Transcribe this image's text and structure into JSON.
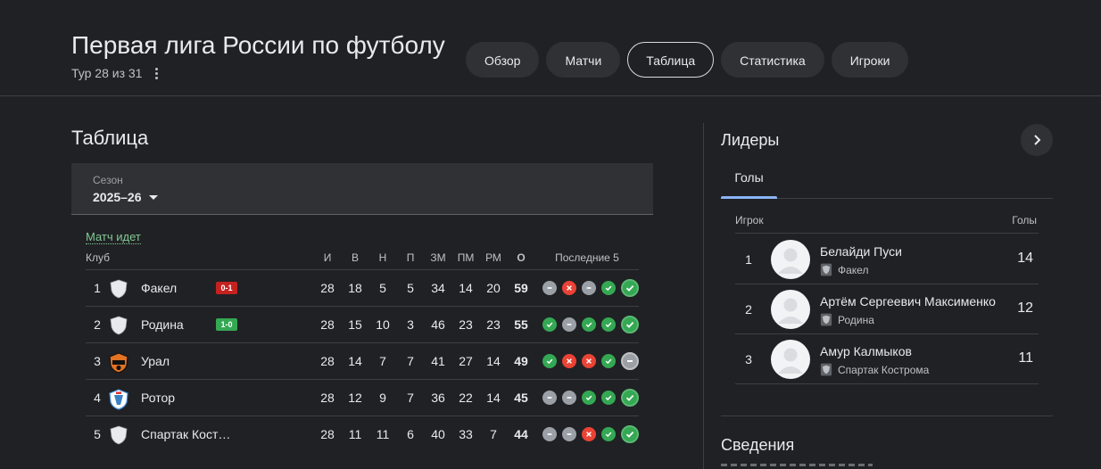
{
  "header": {
    "title": "Первая лига России по футболу",
    "round": "Тур 28 из 31",
    "tabs": [
      {
        "label": "Обзор",
        "active": false
      },
      {
        "label": "Матчи",
        "active": false
      },
      {
        "label": "Таблица",
        "active": true
      },
      {
        "label": "Статистика",
        "active": false
      },
      {
        "label": "Игроки",
        "active": false
      }
    ]
  },
  "standings": {
    "title": "Таблица",
    "season_label": "Сезон",
    "season_value": "2025–26",
    "live_label": "Матч идет",
    "columns": {
      "club": "Клуб",
      "played": "И",
      "won": "В",
      "drawn": "Н",
      "lost": "П",
      "gf": "ЗМ",
      "ga": "ПМ",
      "gd": "РМ",
      "points": "О",
      "form": "Последние 5"
    },
    "rows": [
      {
        "pos": "1",
        "club": "Факел",
        "crest": "shield-white",
        "live_score": "0-1",
        "live_status": "losing",
        "p": "28",
        "w": "18",
        "d": "5",
        "l": "5",
        "gf": "34",
        "ga": "14",
        "gd": "20",
        "pts": "59",
        "form": [
          "D",
          "L",
          "D",
          "W",
          "W"
        ]
      },
      {
        "pos": "2",
        "club": "Родина",
        "crest": "shield-white",
        "live_score": "1-0",
        "live_status": "winning",
        "p": "28",
        "w": "15",
        "d": "10",
        "l": "3",
        "gf": "46",
        "ga": "23",
        "gd": "23",
        "pts": "55",
        "form": [
          "W",
          "D",
          "W",
          "W",
          "W"
        ]
      },
      {
        "pos": "3",
        "club": "Урал",
        "crest": "ural-crest",
        "live_score": "",
        "live_status": "",
        "p": "28",
        "w": "14",
        "d": "7",
        "l": "7",
        "gf": "41",
        "ga": "27",
        "gd": "14",
        "pts": "49",
        "form": [
          "W",
          "L",
          "L",
          "W",
          "D"
        ]
      },
      {
        "pos": "4",
        "club": "Ротор",
        "crest": "rotor-crest",
        "live_score": "",
        "live_status": "",
        "p": "28",
        "w": "12",
        "d": "9",
        "l": "7",
        "gf": "36",
        "ga": "22",
        "gd": "14",
        "pts": "45",
        "form": [
          "D",
          "D",
          "W",
          "W",
          "W"
        ]
      },
      {
        "pos": "5",
        "club": "Спартак Кост…",
        "crest": "shield-white",
        "live_score": "",
        "live_status": "",
        "p": "28",
        "w": "11",
        "d": "11",
        "l": "6",
        "gf": "40",
        "ga": "33",
        "gd": "7",
        "pts": "44",
        "form": [
          "D",
          "D",
          "L",
          "W",
          "W"
        ]
      }
    ],
    "colors": {
      "win": "#34a853",
      "loss": "#ea4335",
      "draw": "#9aa0a6",
      "live_win": "#34a853",
      "live_loss": "#c5221f"
    }
  },
  "leaders": {
    "title": "Лидеры",
    "tab": "Голы",
    "col_player": "Игрок",
    "col_goals": "Голы",
    "players": [
      {
        "rank": "1",
        "name": "Белайди Пуси",
        "team": "Факел",
        "goals": "14"
      },
      {
        "rank": "2",
        "name": "Артём Сергеевич Максименко",
        "team": "Родина",
        "goals": "12"
      },
      {
        "rank": "3",
        "name": "Амур Калмыков",
        "team": "Спартак Кострома",
        "goals": "11"
      }
    ]
  },
  "info": {
    "title": "Сведения"
  }
}
